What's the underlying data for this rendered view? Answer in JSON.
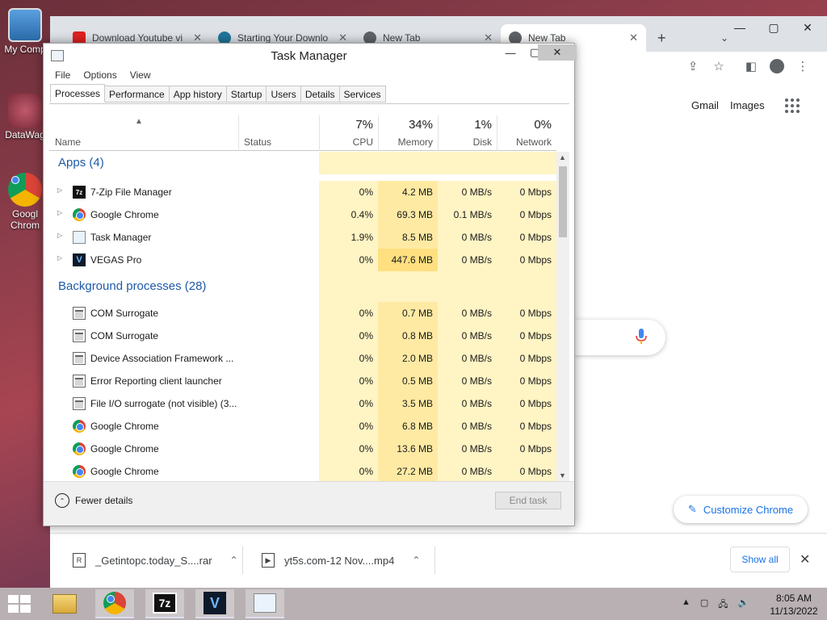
{
  "desktop": {
    "icons": [
      {
        "label": "My Comp"
      },
      {
        "label": "DataWag"
      },
      {
        "label": "Googl Chrom"
      }
    ]
  },
  "chrome": {
    "tabs": [
      {
        "title": "Download Youtube vi"
      },
      {
        "title": "Starting Your Downlo"
      },
      {
        "title": "New Tab"
      },
      {
        "title": "New Tab"
      }
    ],
    "new_tab": "+",
    "page": {
      "gmail": "Gmail",
      "images": "Images",
      "customize": "Customize Chrome"
    },
    "downloads": [
      {
        "name": "_Getintopc.today_S....rar"
      },
      {
        "name": "yt5s.com-12 Nov....mp4"
      }
    ],
    "show_all": "Show all"
  },
  "task_manager": {
    "title": "Task Manager",
    "menu": [
      "File",
      "Options",
      "View"
    ],
    "tabs": [
      "Processes",
      "Performance",
      "App history",
      "Startup",
      "Users",
      "Details",
      "Services"
    ],
    "active_tab": "Processes",
    "columns": {
      "name": "Name",
      "status": "Status",
      "cpu": {
        "pct": "7%",
        "label": "CPU"
      },
      "memory": {
        "pct": "34%",
        "label": "Memory"
      },
      "disk": {
        "pct": "1%",
        "label": "Disk"
      },
      "network": {
        "pct": "0%",
        "label": "Network"
      }
    },
    "groups": [
      {
        "title": "Apps (4)",
        "rows": [
          {
            "name": "7-Zip File Manager",
            "icon": "7zip-icon",
            "cpu": "0%",
            "mem": "4.2 MB",
            "disk": "0 MB/s",
            "net": "0 Mbps"
          },
          {
            "name": "Google Chrome",
            "icon": "chrome-icon",
            "cpu": "0.4%",
            "mem": "69.3 MB",
            "disk": "0.1 MB/s",
            "net": "0 Mbps"
          },
          {
            "name": "Task Manager",
            "icon": "task-manager-icon",
            "cpu": "1.9%",
            "mem": "8.5 MB",
            "disk": "0 MB/s",
            "net": "0 Mbps"
          },
          {
            "name": "VEGAS Pro",
            "icon": "vegas-icon",
            "cpu": "0%",
            "mem": "447.6 MB",
            "disk": "0 MB/s",
            "net": "0 Mbps"
          }
        ]
      },
      {
        "title": "Background processes (28)",
        "rows": [
          {
            "name": "COM Surrogate",
            "icon": "process-icon",
            "cpu": "0%",
            "mem": "0.7 MB",
            "disk": "0 MB/s",
            "net": "0 Mbps"
          },
          {
            "name": "COM Surrogate",
            "icon": "process-icon",
            "cpu": "0%",
            "mem": "0.8 MB",
            "disk": "0 MB/s",
            "net": "0 Mbps"
          },
          {
            "name": "Device Association Framework ...",
            "icon": "process-icon",
            "cpu": "0%",
            "mem": "2.0 MB",
            "disk": "0 MB/s",
            "net": "0 Mbps"
          },
          {
            "name": "Error Reporting client launcher",
            "icon": "process-icon",
            "cpu": "0%",
            "mem": "0.5 MB",
            "disk": "0 MB/s",
            "net": "0 Mbps"
          },
          {
            "name": "File I/O surrogate (not visible) (3...",
            "icon": "process-icon",
            "cpu": "0%",
            "mem": "3.5 MB",
            "disk": "0 MB/s",
            "net": "0 Mbps"
          },
          {
            "name": "Google Chrome",
            "icon": "chrome-icon",
            "cpu": "0%",
            "mem": "6.8 MB",
            "disk": "0 MB/s",
            "net": "0 Mbps"
          },
          {
            "name": "Google Chrome",
            "icon": "chrome-icon",
            "cpu": "0%",
            "mem": "13.6 MB",
            "disk": "0 MB/s",
            "net": "0 Mbps"
          },
          {
            "name": "Google Chrome",
            "icon": "chrome-icon",
            "cpu": "0%",
            "mem": "27.2 MB",
            "disk": "0 MB/s",
            "net": "0 Mbps"
          }
        ]
      }
    ],
    "fewer_details": "Fewer details",
    "end_task": "End task"
  },
  "taskbar": {
    "time": "8:05 AM",
    "date": "11/13/2022"
  },
  "colors": {
    "accent": "#1a73e8",
    "group_title": "#1e5aa8",
    "heat_light": "#fff4c4",
    "heat_mem": "#ffeaa4"
  }
}
